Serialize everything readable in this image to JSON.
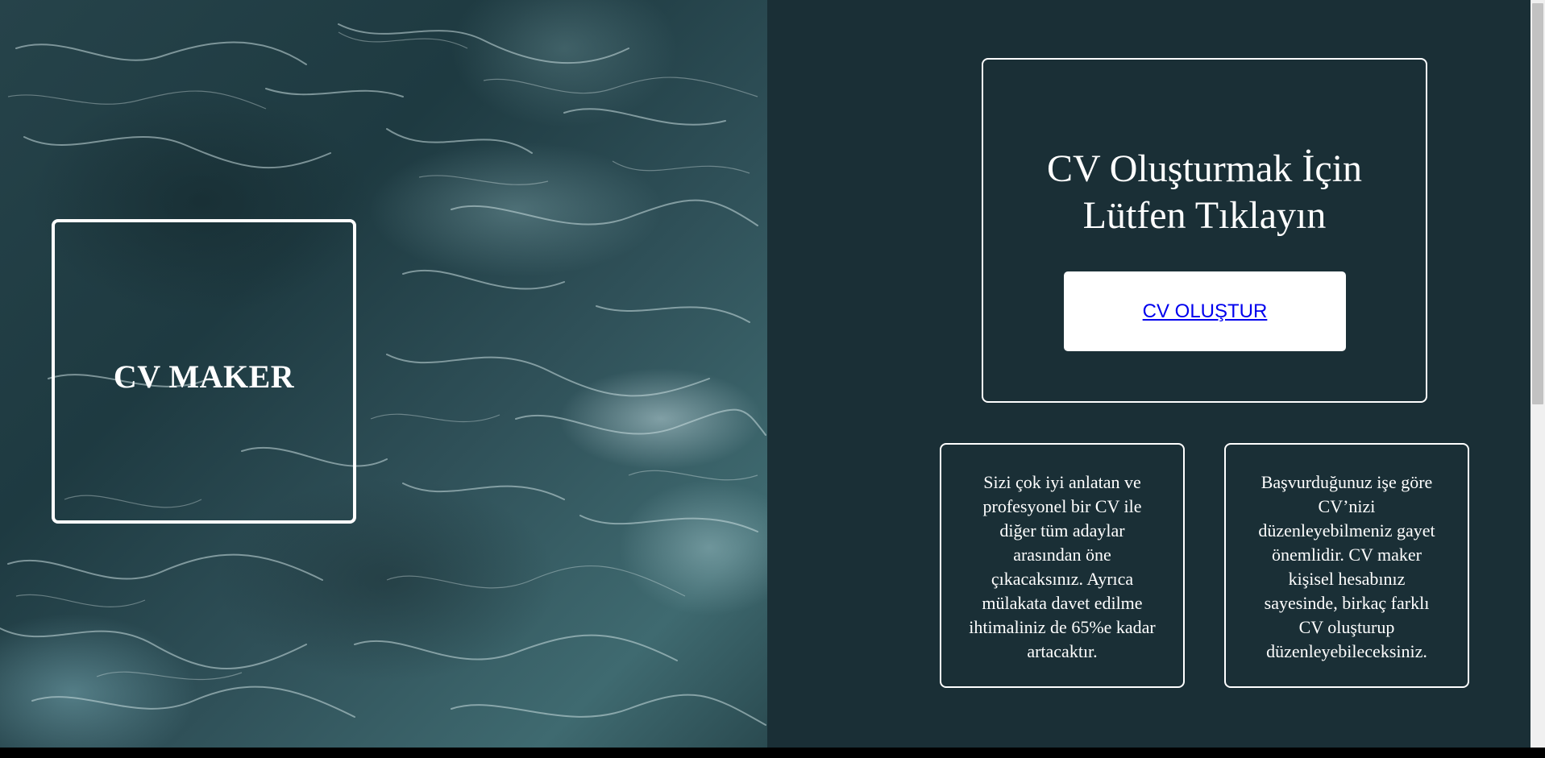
{
  "hero": {
    "logo_text": "CV MAKER",
    "background_image": "ocean-waves-texture"
  },
  "cta": {
    "title": "CV Oluşturmak İçin Lütfen Tıklayın",
    "button_label": "CV OLUŞTUR"
  },
  "features": [
    {
      "text": "Sizi çok iyi anlatan ve profesyonel bir CV ile diğer tüm adaylar arasından öne çıkacaksınız. Ayrıca mülakata davet edilme ihtimaliniz de 65%e kadar artacaktır."
    },
    {
      "text": "Başvurduğunuz işe göre CV’nizi düzenleyebilmeniz gayet önemlidir. CV maker kişisel hesabınız sayesinde, birkaç farklı CV oluşturup düzenleyebileceksiniz."
    }
  ],
  "colors": {
    "panel_background": "#1a2f36",
    "border": "#ffffff",
    "link": "#0000ee"
  }
}
